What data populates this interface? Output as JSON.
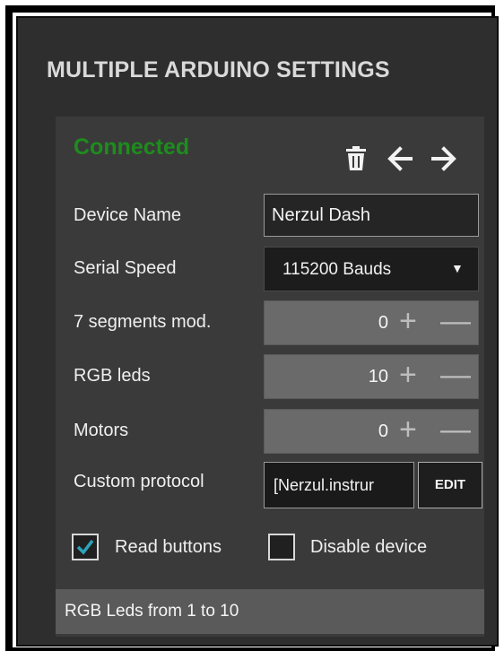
{
  "panel": {
    "title": "MULTIPLE ARDUINO SETTINGS"
  },
  "device": {
    "status": "Connected",
    "status_color": "#1e8c1e",
    "actions": {
      "delete_icon": "trash-icon",
      "prev_icon": "arrow-left-icon",
      "next_icon": "arrow-right-icon"
    },
    "fields": {
      "device_name": {
        "label": "Device Name",
        "value": "Nerzul Dash"
      },
      "serial_speed": {
        "label": "Serial Speed",
        "value": "115200 Bauds"
      },
      "seven_segments": {
        "label": "7 segments mod.",
        "value": "0"
      },
      "rgb_leds": {
        "label": "RGB leds",
        "value": "10"
      },
      "motors": {
        "label": "Motors",
        "value": "0"
      },
      "custom_protocol": {
        "label": "Custom protocol",
        "value": "[Nerzul.instrur",
        "edit_label": "EDIT"
      }
    },
    "checkboxes": {
      "read_buttons": {
        "label": "Read buttons",
        "checked": true
      },
      "disable_device": {
        "label": "Disable device",
        "checked": false
      }
    },
    "footer": "RGB Leds from 1 to 10"
  },
  "colors": {
    "background": "#2e2e2e",
    "accent_check": "#2aa3b8"
  }
}
